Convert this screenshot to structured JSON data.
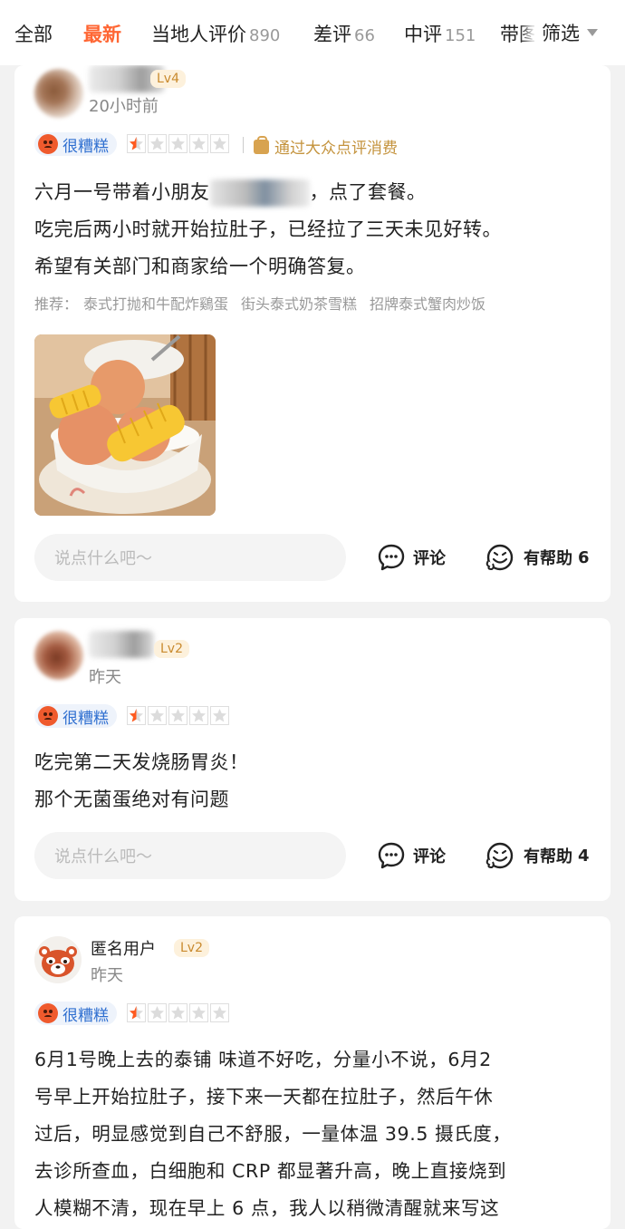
{
  "tabs": [
    {
      "label": "全部",
      "count": ""
    },
    {
      "label": "最新",
      "count": "",
      "active": true
    },
    {
      "label": "当地人评价",
      "count": "890"
    },
    {
      "label": "差评",
      "count": "66"
    },
    {
      "label": "中评",
      "count": "151"
    },
    {
      "label": "带图",
      "count": ""
    }
  ],
  "filter_label": "筛选",
  "reviews": [
    {
      "user": "",
      "level": "Lv4",
      "time": "20小时前",
      "rating_label": "很糟糕",
      "stars": 0.5,
      "consume_label": "通过大众点评消费",
      "lines": [
        {
          "before": "六月一号带着小朋友",
          "after": "，点了套餐。"
        },
        {
          "text": "吃完后两小时就开始拉肚子，已经拉了三天未见好转。"
        },
        {
          "text": "希望有关部门和商家给一个明确答复。"
        }
      ],
      "recommend_label": "推荐：",
      "recommend": [
        "泰式打抛和牛配炸鷄蛋",
        "街头泰式奶茶雪糕",
        "招牌泰式蟹肉炒饭"
      ],
      "comment_placeholder": "说点什么吧～",
      "comment_label": "评论",
      "helpful_label": "有帮助",
      "helpful_count": "6"
    },
    {
      "user": "",
      "level": "Lv2",
      "time": "昨天",
      "rating_label": "很糟糕",
      "stars": 0.5,
      "lines": [
        {
          "text": "吃完第二天发烧肠胃炎！"
        },
        {
          "text": "那个无菌蛋绝对有问题"
        }
      ],
      "comment_placeholder": "说点什么吧～",
      "comment_label": "评论",
      "helpful_label": "有帮助",
      "helpful_count": "4"
    },
    {
      "user": "匿名用户",
      "level": "Lv2",
      "time": "昨天",
      "rating_label": "很糟糕",
      "stars": 0.5,
      "lines": [
        {
          "text": "6月1号晚上去的泰铺 味道不好吃，分量小不说，6月2"
        },
        {
          "text": "号早上开始拉肚子，接下来一天都在拉肚子，然后午休"
        },
        {
          "text": "过后，明显感觉到自己不舒服，一量体温 39.5 摄氏度，"
        },
        {
          "text": "去诊所查血，白细胞和 CRP 都显著升高，晚上直接烧到"
        },
        {
          "text": "人模糊不清，现在早上 6 点，我人以稍微清醒就来写这"
        }
      ]
    }
  ],
  "colors": {
    "accent": "#ff6633",
    "star_fill": "#ff5a1f",
    "badge_text": "#2f6fd0",
    "consume": "#c4933d"
  }
}
